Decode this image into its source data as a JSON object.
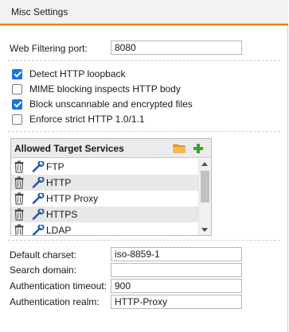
{
  "panel": {
    "title": "Misc Settings"
  },
  "web_filtering": {
    "label": "Web Filtering port:",
    "value": "8080"
  },
  "checkboxes": [
    {
      "label": "Detect HTTP loopback",
      "checked": true
    },
    {
      "label": "MIME blocking inspects HTTP body",
      "checked": false
    },
    {
      "label": "Block unscannable and encrypted files",
      "checked": true
    },
    {
      "label": "Enforce strict HTTP 1.0/1.1",
      "checked": false
    }
  ],
  "services": {
    "title": "Allowed Target Services",
    "header_icons": [
      "folder-icon",
      "add-icon"
    ],
    "items": [
      "FTP",
      "HTTP",
      "HTTP Proxy",
      "HTTPS",
      "LDAP"
    ],
    "row_icons": [
      "trash-icon",
      "wrench-icon"
    ]
  },
  "fields": {
    "default_charset": {
      "label": "Default charset:",
      "value": "iso-8859-1"
    },
    "search_domain": {
      "label": "Search domain:",
      "value": ""
    },
    "auth_timeout": {
      "label": "Authentication timeout:",
      "value": "900"
    },
    "auth_realm": {
      "label": "Authentication realm:",
      "value": "HTTP-Proxy"
    }
  },
  "colors": {
    "accent": "#ee7d18",
    "checkbox": "#1a73e8",
    "add_icon": "#3aa335",
    "folder_icon": "#f0a020",
    "wrench_icon": "#2455b5"
  }
}
